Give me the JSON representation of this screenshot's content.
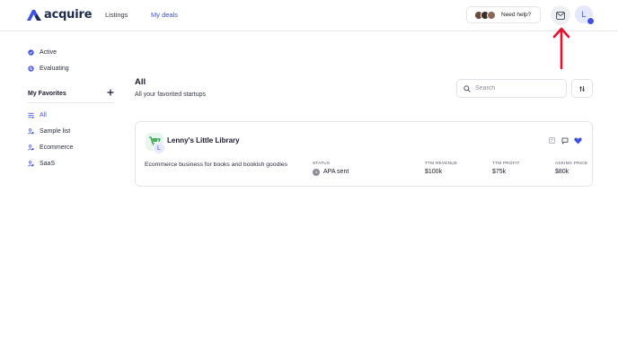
{
  "header": {
    "brand": "acquire",
    "nav": {
      "listings": "Listings",
      "my_deals": "My deals"
    },
    "help_label": "Need help?",
    "avatar_initial": "L",
    "colors": {
      "accent": "#3f51e5",
      "brand_dark": "#1d2c4c",
      "arrow": "#e8112d"
    }
  },
  "sidebar": {
    "status_items": [
      {
        "label": "Active",
        "icon": "check-badge-icon"
      },
      {
        "label": "Evaluating",
        "icon": "search-badge-icon"
      }
    ],
    "favorites_heading": "My Favorites",
    "favorites": [
      {
        "label": "All",
        "icon": "list-icon"
      },
      {
        "label": "Sample list",
        "icon": "folder-user-icon"
      },
      {
        "label": "Ecommerce",
        "icon": "folder-user-icon"
      },
      {
        "label": "SaaS",
        "icon": "folder-user-icon"
      }
    ]
  },
  "main": {
    "title": "All",
    "subtitle": "All your favorited startups",
    "search_placeholder": "Search"
  },
  "deal": {
    "name": "Lenny's Little Library",
    "letter": "L",
    "description": "Ecommerce business for books and bookish goodies",
    "status_label": "STATUS",
    "status_value": "APA sent",
    "revenue_label": "TTM REVENUE",
    "revenue_value": "$100k",
    "profit_label": "TTM PROFIT",
    "profit_value": "$75k",
    "price_label": "ASKING PRICE",
    "price_value": "$80k"
  }
}
